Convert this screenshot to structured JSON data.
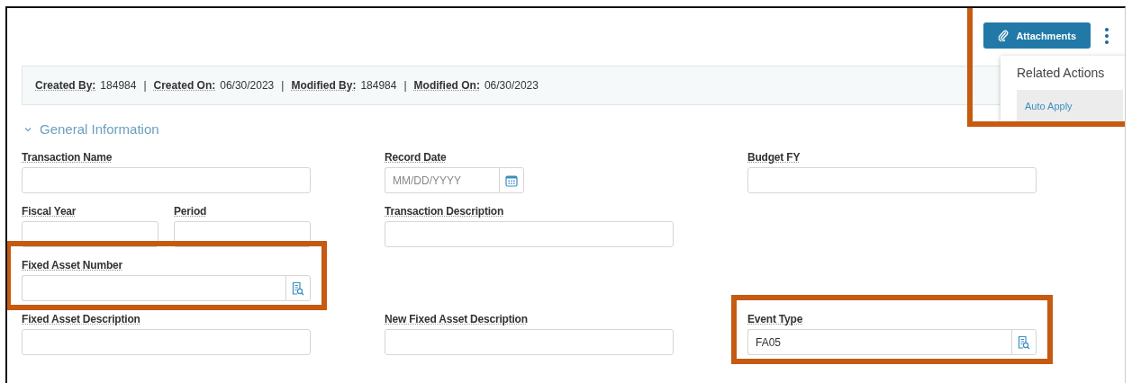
{
  "actions": {
    "attachments_label": "Attachments",
    "highlighted": true,
    "menu": {
      "open": true,
      "title": "Related Actions",
      "items": [
        {
          "label": "Auto Apply",
          "selected": true
        }
      ]
    }
  },
  "meta": [
    {
      "label": "Created By:",
      "value": "184984"
    },
    {
      "label": "Created On:",
      "value": "06/30/2023"
    },
    {
      "label": "Modified By:",
      "value": "184984"
    },
    {
      "label": "Modified On:",
      "value": "06/30/2023"
    }
  ],
  "meta_separator": "|",
  "section": {
    "title": "General Information",
    "expanded": true
  },
  "rows": [
    {
      "fields": [
        {
          "label": "Transaction Name",
          "kind": "text",
          "highlighted": false
        },
        {
          "label": "Record Date",
          "kind": "date",
          "placeholder": "MM/DD/YYYY",
          "highlighted": false
        },
        {
          "label": "Budget FY",
          "kind": "text",
          "highlighted": false
        }
      ]
    },
    {
      "fields": [
        {
          "label": "Fiscal Year",
          "kind": "half",
          "highlighted": false
        },
        {
          "label": "Period",
          "kind": "half",
          "highlighted": false
        },
        {
          "label": "Transaction Description",
          "kind": "text",
          "highlighted": false
        }
      ]
    },
    {
      "fields": [
        {
          "label": "Fixed Asset Number",
          "kind": "lookup",
          "highlighted": true
        }
      ]
    },
    {
      "fields": [
        {
          "label": "Fixed Asset Description",
          "kind": "text",
          "highlighted": false
        },
        {
          "label": "New Fixed Asset Description",
          "kind": "text",
          "highlighted": false
        },
        {
          "label": "Event Type",
          "kind": "lookup",
          "value": "FA05",
          "highlighted": true
        }
      ]
    }
  ]
}
